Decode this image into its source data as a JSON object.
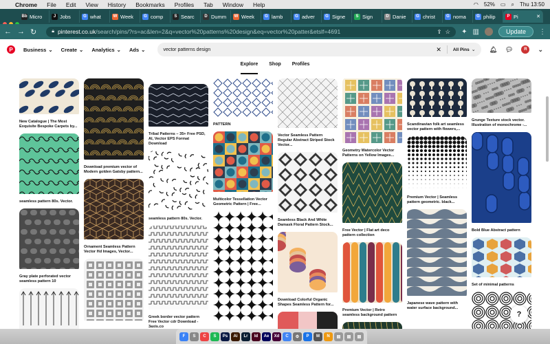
{
  "menubar": {
    "apple": "",
    "app": "Chrome",
    "items": [
      "File",
      "Edit",
      "View",
      "History",
      "Bookmarks",
      "Profiles",
      "Tab",
      "Window",
      "Help"
    ],
    "battery": "52%",
    "clock": "Thu 13:50"
  },
  "tabs": [
    {
      "label": "Micro",
      "fav": "Bb",
      "color": "#222"
    },
    {
      "label": "Jobs",
      "fav": "J",
      "color": "#111"
    },
    {
      "label": "what",
      "fav": "G",
      "color": "#4285f4"
    },
    {
      "label": "Week",
      "fav": "W",
      "color": "#e63"
    },
    {
      "label": "comp",
      "fav": "G",
      "color": "#4285f4"
    },
    {
      "label": "Searc",
      "fav": "S",
      "color": "#222"
    },
    {
      "label": "Dumm",
      "fav": "D",
      "color": "#333"
    },
    {
      "label": "Week",
      "fav": "W",
      "color": "#e63"
    },
    {
      "label": "lamb",
      "fav": "G",
      "color": "#4285f4"
    },
    {
      "label": "adver",
      "fav": "G",
      "color": "#4285f4"
    },
    {
      "label": "Signe",
      "fav": "G",
      "color": "#4285f4"
    },
    {
      "label": "Sign",
      "fav": "S",
      "color": "#2a5"
    },
    {
      "label": "Danie",
      "fav": "D",
      "color": "#888"
    },
    {
      "label": "christ",
      "fav": "G",
      "color": "#4285f4"
    },
    {
      "label": "noma",
      "fav": "G",
      "color": "#4285f4"
    },
    {
      "label": "philip",
      "fav": "G",
      "color": "#4285f4"
    },
    {
      "label": "Pi",
      "fav": "P",
      "color": "#e60023",
      "active": true
    }
  ],
  "toolbar": {
    "url_domain": "pinterest.co.uk",
    "url_path": "/search/pins/?rs=ac&len=2&q=vector%20patterns%20design&eq=vector%20patter&etslf=4691",
    "update": "Update"
  },
  "header": {
    "business": "Business",
    "create": "Create",
    "analytics": "Analytics",
    "ads": "Ads",
    "search_value": "vector patterns design",
    "all_pins": "All Pins"
  },
  "subnav": {
    "explore": "Explore",
    "shop": "Shop",
    "profiles": "Profiles"
  },
  "pins": [
    [
      {
        "cap": "New Catalogue | The Most Exquisite Bespoke Carpets by...",
        "h": 52,
        "pat": "koi"
      },
      {
        "cap": "seamless pattern 80s. Vector.",
        "h": 88,
        "pat": "green"
      },
      {
        "cap": "Gray plate perforated vector seamless pattern 10",
        "h": 88,
        "pat": "gray"
      },
      {
        "cap": "",
        "h": 60,
        "pat": "arrows"
      }
    ],
    [
      {
        "cap": "Download premium vector of Modern golden Gatsby pattern...",
        "h": 118,
        "pat": "gatsby"
      },
      {
        "cap": "Ornament Seamless Pattern Vector Hd Images, Vector...",
        "h": 88,
        "pat": "cubes"
      },
      {
        "cap": "",
        "h": 90,
        "pat": "tiles"
      }
    ],
    [
      {
        "cap": "Tribal Patterns – 35+ Free PSD, AI, Vector EPS Format Download",
        "h": 62,
        "pat": "tribal"
      },
      {
        "cap": "seamless pattern 80s. Vector.",
        "h": 88,
        "pat": "squiggle"
      },
      {
        "cap": "Greek border vector pattern Free Vector cdr Download - 3axis.co",
        "h": 122,
        "pat": "greek"
      }
    ],
    [
      {
        "cap": "PATTERN",
        "h": 56,
        "pat": "blue"
      },
      {
        "cap": "Multicolor Tessellation Vector Geometric Pattern | Free...",
        "h": 88,
        "pat": "tess"
      },
      {
        "cap": "",
        "h": 160,
        "pat": "stars"
      }
    ],
    [
      {
        "cap": "Vector Seamless Pattern Regular Abstract Striped Stock Vector...",
        "h": 72,
        "pat": "stripes"
      },
      {
        "cap": "Seamless Black And White Damask Floral Pattern Stock...",
        "h": 88,
        "pat": "damask"
      },
      {
        "cap": "Download Colorful Organic Shapes Seamless Pattern for...",
        "h": 88,
        "pat": "organic"
      },
      {
        "cap": "",
        "h": 30,
        "pat": "pink"
      }
    ],
    [
      {
        "cap": "Geometry Watercolor Vector Patterns on Yellow Images...",
        "h": 96,
        "pat": "watercolor"
      },
      {
        "cap": "Free Vector | Flat art deco pattern collection",
        "h": 88,
        "pat": "deco"
      },
      {
        "cap": "Premium Vector | Retro seamless background pattern",
        "h": 88,
        "pat": "retro"
      },
      {
        "cap": "",
        "h": 30,
        "pat": "dark"
      }
    ],
    [
      {
        "cap": "Scandinavian folk art seamless vector pattern with flowers,...",
        "h": 56,
        "pat": "folk"
      },
      {
        "cap": "Premium Vector | Seamless pattern geometric. black...",
        "h": 78,
        "pat": "gradient"
      },
      {
        "cap": "Japanese wave pattern with water surface background...",
        "h": 126,
        "pat": "wave"
      }
    ],
    [
      {
        "cap": "Grunge Texture stock vector. Illustration of monochrome -...",
        "h": 50,
        "pat": "grunge"
      },
      {
        "cap": "Bold Blue Abstract pattern",
        "h": 132,
        "pat": "boldblue"
      },
      {
        "cap": "Set of minimal patterns",
        "h": 58,
        "pat": "boxes"
      },
      {
        "cap": "",
        "h": 60,
        "pat": "swirl"
      }
    ]
  ],
  "help": "?",
  "dock": [
    {
      "l": "F",
      "c": "#3b82f6"
    },
    {
      "l": "S",
      "c": "#888"
    },
    {
      "l": "C",
      "c": "#e44"
    },
    {
      "l": "S",
      "c": "#1db954"
    },
    {
      "l": "Ps",
      "c": "#0a1a44"
    },
    {
      "l": "Ai",
      "c": "#3a1a00"
    },
    {
      "l": "Lr",
      "c": "#0b1e33"
    },
    {
      "l": "Id",
      "c": "#49021f"
    },
    {
      "l": "Ae",
      "c": "#00005b"
    },
    {
      "l": "Xd",
      "c": "#470137"
    },
    {
      "l": "C",
      "c": "#4285f4"
    },
    {
      "l": "⚙",
      "c": "#777"
    },
    {
      "l": "P",
      "c": "#1a73e8"
    },
    {
      "l": "M",
      "c": "#555"
    },
    {
      "l": "N",
      "c": "#e91"
    },
    {
      "l": "▤",
      "c": "#999"
    },
    {
      "l": "▤",
      "c": "#999"
    },
    {
      "l": "▤",
      "c": "#999"
    }
  ]
}
